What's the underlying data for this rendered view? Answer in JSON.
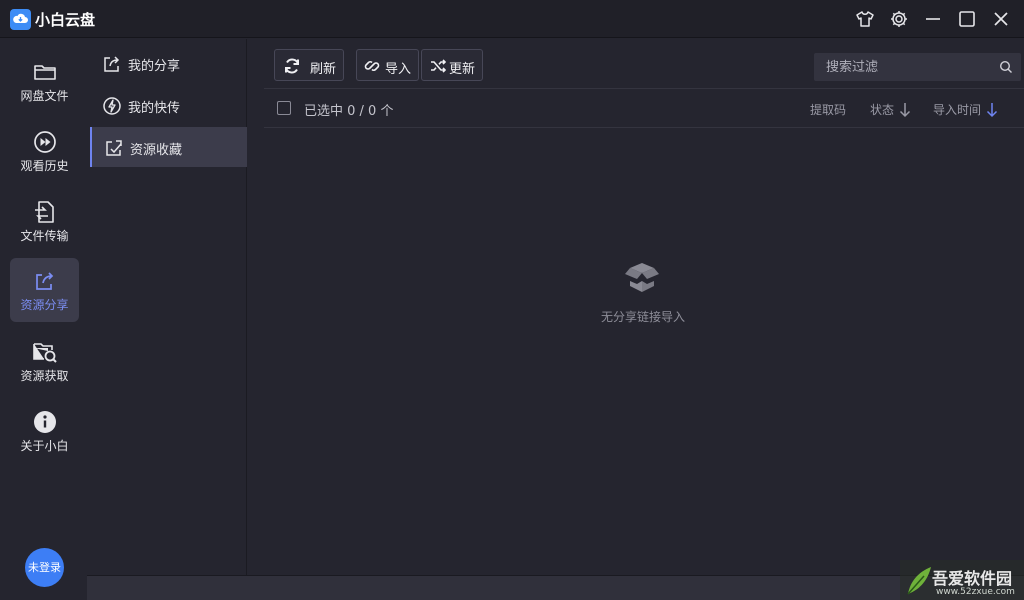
{
  "app": {
    "title": "小白云盘"
  },
  "nav": {
    "items": [
      {
        "label": "网盘文件",
        "icon": "folder-icon"
      },
      {
        "label": "观看历史",
        "icon": "fast-forward-icon"
      },
      {
        "label": "文件传输",
        "icon": "transfer-icon"
      },
      {
        "label": "资源分享",
        "icon": "share-icon",
        "active": true
      },
      {
        "label": "资源获取",
        "icon": "folder-search-icon"
      },
      {
        "label": "关于小白",
        "icon": "info-icon"
      }
    ],
    "avatar_label": "未登录"
  },
  "submenu": {
    "items": [
      {
        "label": "我的分享",
        "icon": "share-out-icon"
      },
      {
        "label": "我的快传",
        "icon": "flash-icon"
      },
      {
        "label": "资源收藏",
        "icon": "collect-icon",
        "active": true
      }
    ]
  },
  "toolbar": {
    "refresh_label": "刷新",
    "import_label": "导入",
    "update_label": "更新"
  },
  "search": {
    "placeholder": "搜索过滤"
  },
  "list": {
    "selected_label": "已选中 0 / 0 个",
    "columns": {
      "code": "提取码",
      "status": "状态",
      "import_time": "导入时间"
    },
    "empty_text": "无分享链接导入"
  },
  "watermark": {
    "name": "吾爱软件园",
    "url": "www.52zxue.com"
  },
  "colors": {
    "accent": "#6f84f0",
    "brand": "#3d8cf5",
    "background": "#25252f"
  }
}
